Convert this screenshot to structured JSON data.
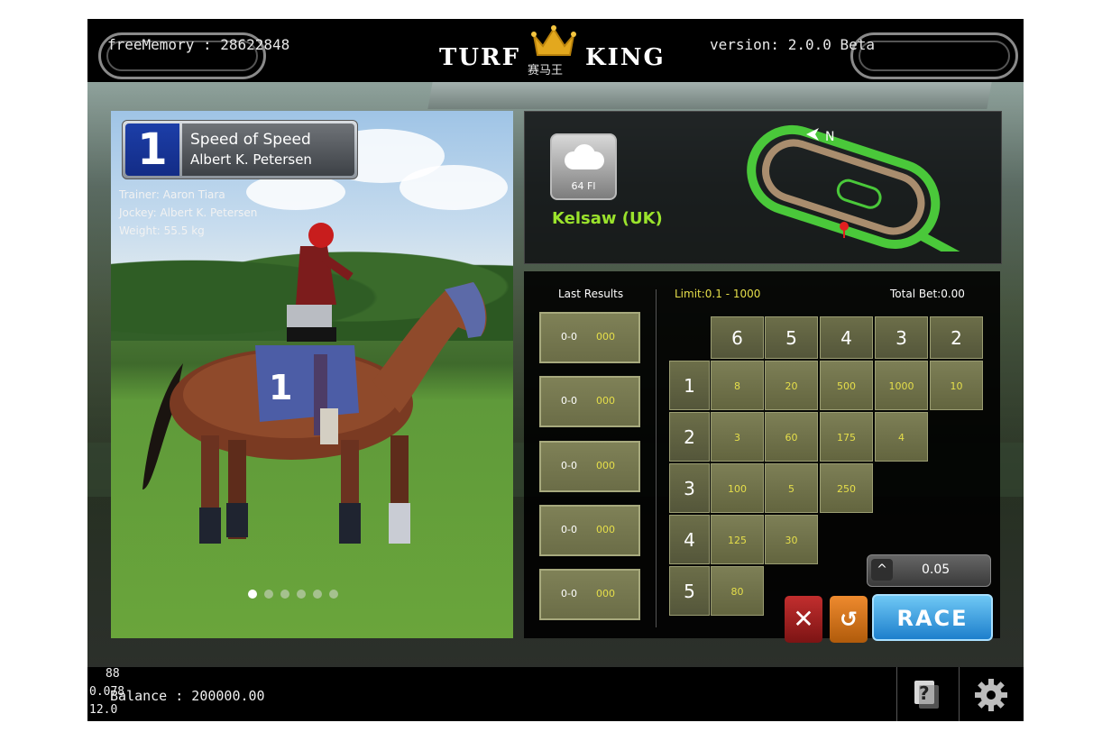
{
  "top": {
    "memory": "freeMemory : 28622848",
    "version": "version: 2.0.0 Beta",
    "logo_word1": "TURF",
    "logo_word2": "KING",
    "logo_cn": "赛马王"
  },
  "horse": {
    "number": "1",
    "name": "Speed of Speed",
    "jockey_short": "Albert K. Petersen",
    "trainer": "Trainer: Aaron Tiara",
    "jockey": "Jockey: Albert K. Petersen",
    "weight": "Weight: 55.5 kg",
    "saddle_number": "1",
    "carousel": {
      "count": 6,
      "active": 0
    }
  },
  "track": {
    "weather_temp": "64 Fl",
    "weather_icon": "cloud-icon",
    "venue": "Kelsaw (UK)",
    "compass": "N"
  },
  "betting": {
    "last_results_title": "Last Results",
    "last_results": [
      {
        "score": "0-0",
        "amount": "000"
      },
      {
        "score": "0-0",
        "amount": "000"
      },
      {
        "score": "0-0",
        "amount": "000"
      },
      {
        "score": "0-0",
        "amount": "000"
      },
      {
        "score": "0-0",
        "amount": "000"
      }
    ],
    "limit": "Limit:0.1 - 1000",
    "total_bet": "Total Bet:0.00",
    "col_headers": [
      "6",
      "5",
      "4",
      "3",
      "2"
    ],
    "row_headers": [
      "1",
      "2",
      "3",
      "4",
      "5"
    ],
    "odds": [
      [
        "8",
        "20",
        "500",
        "1000",
        "10"
      ],
      [
        "3",
        "60",
        "175",
        "4"
      ],
      [
        "100",
        "5",
        "250"
      ],
      [
        "125",
        "30"
      ],
      [
        "80"
      ]
    ],
    "chip_value": "0.05",
    "race_label": "RACE",
    "clear_symbol": "✕",
    "undo_symbol": "↺"
  },
  "bottom": {
    "debug_fps": "88",
    "debug_a": "0.078",
    "debug_b": "12.0",
    "balance": "Balance : 200000.00"
  },
  "colors": {
    "accent_yellow": "#e6df4a",
    "venue_green": "#9be32c",
    "race_blue": "#1d7fcc",
    "cell_olive": "#6b6d47"
  }
}
